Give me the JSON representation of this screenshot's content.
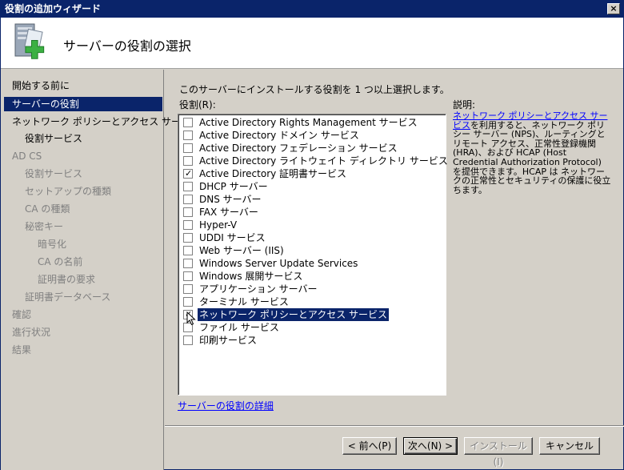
{
  "window": {
    "title": "役割の追加ウィザード",
    "close_label": "×"
  },
  "header": {
    "title": "サーバーの役割の選択",
    "icon": "server-add-icon"
  },
  "sidebar": {
    "items": [
      {
        "label": "開始する前に",
        "state": "normal"
      },
      {
        "label": "サーバーの役割",
        "state": "selected"
      },
      {
        "label": "ネットワーク ポリシーとアクセス サービ...",
        "state": "normal"
      },
      {
        "label": "役割サービス",
        "state": "normal"
      },
      {
        "label": "AD CS",
        "state": "disabled"
      },
      {
        "label": "役割サービス",
        "state": "disabled"
      },
      {
        "label": "セットアップの種類",
        "state": "disabled"
      },
      {
        "label": "CA の種類",
        "state": "disabled"
      },
      {
        "label": "秘密キー",
        "state": "disabled"
      },
      {
        "label": "暗号化",
        "state": "disabled"
      },
      {
        "label": "CA の名前",
        "state": "disabled"
      },
      {
        "label": "証明書の要求",
        "state": "disabled"
      },
      {
        "label": "証明書データベース",
        "state": "disabled"
      },
      {
        "label": "確認",
        "state": "disabled"
      },
      {
        "label": "進行状況",
        "state": "disabled"
      },
      {
        "label": "結果",
        "state": "disabled"
      }
    ]
  },
  "main": {
    "instruction": "このサーバーにインストールする役割を 1 つ以上選択します。",
    "roles_label": "役割(R):",
    "roles": [
      {
        "label": "Active Directory Rights Management サービス",
        "checked": false
      },
      {
        "label": "Active Directory ドメイン サービス",
        "checked": false
      },
      {
        "label": "Active Directory フェデレーション サービス",
        "checked": false
      },
      {
        "label": "Active Directory ライトウェイト ディレクトリ サービス",
        "checked": false
      },
      {
        "label": "Active Directory 証明書サービス",
        "checked": true
      },
      {
        "label": "DHCP サーバー",
        "checked": false
      },
      {
        "label": "DNS サーバー",
        "checked": false
      },
      {
        "label": "FAX サーバー",
        "checked": false
      },
      {
        "label": "Hyper-V",
        "checked": false
      },
      {
        "label": "UDDI サービス",
        "checked": false
      },
      {
        "label": "Web サーバー (IIS)",
        "checked": false
      },
      {
        "label": "Windows Server Update Services",
        "checked": false
      },
      {
        "label": "Windows 展開サービス",
        "checked": false
      },
      {
        "label": "アプリケーション サーバー",
        "checked": false
      },
      {
        "label": "ターミナル サービス",
        "checked": false
      },
      {
        "label": "ネットワーク ポリシーとアクセス サービス",
        "checked": true,
        "selected": true
      },
      {
        "label": "ファイル サービス",
        "checked": false
      },
      {
        "label": "印刷サービス",
        "checked": false
      }
    ],
    "description_label": "説明:",
    "description_link": "ネットワーク ポリシーとアクセス サービス",
    "description_text": "を利用すると、ネットワーク ポリシー サーバー (NPS)、ルーティングとリモート アクセス、正常性登録機関 (HRA)、および HCAP (Host Credential Authorization Protocol) を提供できます。HCAP は ネットワークの正常性とセキュリティの保護に役立ちます。",
    "detail_link": "サーバーの役割の詳細"
  },
  "buttons": {
    "back": "< 前へ(P)",
    "next": "次へ(N) >",
    "install": "インストール(I)",
    "cancel": "キャンセル"
  }
}
